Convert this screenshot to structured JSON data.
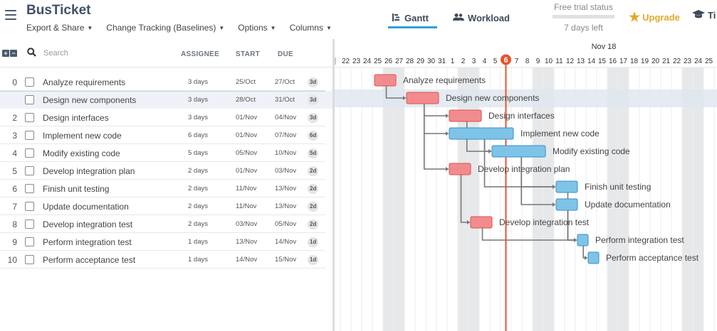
{
  "app": {
    "title": "BusTicket"
  },
  "menu": [
    {
      "label": "Export & Share"
    },
    {
      "label": "Change Tracking (Baselines)"
    },
    {
      "label": "Options"
    },
    {
      "label": "Columns"
    }
  ],
  "view_tabs": [
    {
      "label": "Gantt",
      "active": true
    },
    {
      "label": "Workload",
      "active": false
    }
  ],
  "trial": {
    "status": "Free trial status",
    "days": "7 days left"
  },
  "upgrade": {
    "label": "Upgrade"
  },
  "extra_tab": {
    "label": "Ti"
  },
  "grid": {
    "search_placeholder": "Search",
    "columns": {
      "assignee": "ASSIGNEE",
      "start": "START",
      "due": "DUE"
    },
    "rows": [
      {
        "num": "0",
        "name": "Analyze requirements",
        "assignee": "3 days",
        "start": "25/Oct",
        "due": "27/Oct",
        "badge": "3d",
        "selected": false
      },
      {
        "num": "",
        "name": "Design new components",
        "assignee": "3 days",
        "start": "28/Oct",
        "due": "31/Oct",
        "badge": "3d",
        "selected": true
      },
      {
        "num": "2",
        "name": "Design interfaces",
        "assignee": "3 days",
        "start": "01/Nov",
        "due": "04/Nov",
        "badge": "3d",
        "selected": false
      },
      {
        "num": "3",
        "name": "Implement new code",
        "assignee": "6 days",
        "start": "01/Nov",
        "due": "07/Nov",
        "badge": "6d",
        "selected": false
      },
      {
        "num": "4",
        "name": "Modify existing code",
        "assignee": "5 days",
        "start": "05/Nov",
        "due": "10/Nov",
        "badge": "5d",
        "selected": false
      },
      {
        "num": "5",
        "name": "Develop integration plan",
        "assignee": "2 days",
        "start": "01/Nov",
        "due": "03/Nov",
        "badge": "2d",
        "selected": false
      },
      {
        "num": "6",
        "name": "Finish unit testing",
        "assignee": "2 days",
        "start": "11/Nov",
        "due": "13/Nov",
        "badge": "2d",
        "selected": false
      },
      {
        "num": "7",
        "name": "Update documentation",
        "assignee": "2 days",
        "start": "11/Nov",
        "due": "13/Nov",
        "badge": "2d",
        "selected": false
      },
      {
        "num": "8",
        "name": "Develop integration test",
        "assignee": "2 days",
        "start": "03/Nov",
        "due": "05/Nov",
        "badge": "2d",
        "selected": false
      },
      {
        "num": "9",
        "name": "Perform integration test",
        "assignee": "1 days",
        "start": "13/Nov",
        "due": "14/Nov",
        "badge": "1d",
        "selected": false
      },
      {
        "num": "10",
        "name": "Perform acceptance test",
        "assignee": "1 days",
        "start": "14/Nov",
        "due": "15/Nov",
        "badge": "1d",
        "selected": false
      }
    ]
  },
  "timeline": {
    "month_label": "Nov 18",
    "today_label": "6",
    "days": [
      "22",
      "23",
      "24",
      "25",
      "26",
      "27",
      "28",
      "29",
      "30",
      "31",
      "1",
      "2",
      "3",
      "4",
      "5",
      "6",
      "7",
      "8",
      "9",
      "10",
      "11",
      "12",
      "13",
      "14",
      "15",
      "16",
      "17",
      "18",
      "19",
      "20",
      "21",
      "22",
      "23",
      "24",
      "25"
    ],
    "weekend_days": [
      26,
      27,
      2,
      3,
      9,
      10,
      16,
      17,
      23,
      24
    ],
    "colors": {
      "critical": "#f28b8e",
      "critical_border": "#d9534f",
      "normal": "#7ec4e8",
      "normal_border": "#3a8fc0",
      "today": "#e8532a",
      "weekend": "#e6e8ea",
      "link": "#777777"
    }
  },
  "tasks": [
    {
      "row": 0,
      "start_day": "25/Oct",
      "due_day": "27/Oct",
      "critical": true
    },
    {
      "row": 1,
      "start_day": "28/Oct",
      "due_day": "31/Oct",
      "critical": true
    },
    {
      "row": 2,
      "start_day": "01/Nov",
      "due_day": "04/Nov",
      "critical": true
    },
    {
      "row": 3,
      "start_day": "01/Nov",
      "due_day": "07/Nov",
      "critical": false
    },
    {
      "row": 4,
      "start_day": "05/Nov",
      "due_day": "10/Nov",
      "critical": false
    },
    {
      "row": 5,
      "start_day": "01/Nov",
      "due_day": "03/Nov",
      "critical": true
    },
    {
      "row": 6,
      "start_day": "11/Nov",
      "due_day": "13/Nov",
      "critical": false
    },
    {
      "row": 7,
      "start_day": "11/Nov",
      "due_day": "13/Nov",
      "critical": false
    },
    {
      "row": 8,
      "start_day": "03/Nov",
      "due_day": "05/Nov",
      "critical": true
    },
    {
      "row": 9,
      "start_day": "13/Nov",
      "due_day": "14/Nov",
      "critical": false
    },
    {
      "row": 10,
      "start_day": "14/Nov",
      "due_day": "15/Nov",
      "critical": false
    }
  ],
  "links": [
    {
      "from": 0,
      "to": 1
    },
    {
      "from": 1,
      "to": 2
    },
    {
      "from": 1,
      "to": 3
    },
    {
      "from": 1,
      "to": 5
    },
    {
      "from": 3,
      "to": 4
    },
    {
      "from": 2,
      "to": 4
    },
    {
      "from": 4,
      "to": 6
    },
    {
      "from": 4,
      "to": 7
    },
    {
      "from": 3,
      "to": 6
    },
    {
      "from": 5,
      "to": 8
    },
    {
      "from": 8,
      "to": 9
    },
    {
      "from": 6,
      "to": 9
    },
    {
      "from": 7,
      "to": 9
    },
    {
      "from": 9,
      "to": 10
    }
  ]
}
